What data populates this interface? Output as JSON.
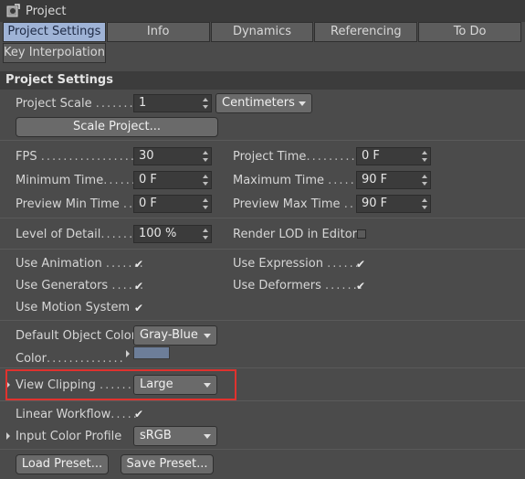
{
  "window": {
    "title": "Project",
    "icon": "project-gear-icon"
  },
  "tabs": [
    {
      "label": "Project Settings",
      "active": true
    },
    {
      "label": "Info",
      "active": false
    },
    {
      "label": "Dynamics",
      "active": false
    },
    {
      "label": "Referencing",
      "active": false
    },
    {
      "label": "To Do",
      "active": false
    }
  ],
  "tabs_row2": [
    {
      "label": "Key Interpolation",
      "active": false
    }
  ],
  "section": {
    "title": "Project Settings"
  },
  "project_scale": {
    "label": "Project Scale",
    "dots": "........",
    "value": "1",
    "unit": "Centimeters",
    "scale_button": "Scale Project..."
  },
  "time": {
    "fps": {
      "label": "FPS",
      "dots": "...................",
      "value": "30"
    },
    "project_time": {
      "label": "Project Time",
      "dots": "..........",
      "value": "0 F"
    },
    "min_time": {
      "label": "Minimum Time",
      "dots": "......",
      "value": "0 F"
    },
    "max_time": {
      "label": "Maximum Time",
      "dots": ".....",
      "value": "90 F"
    },
    "preview_min": {
      "label": "Preview Min Time",
      "dots": "..",
      "value": "0 F"
    },
    "preview_max": {
      "label": "Preview Max Time",
      "dots": "...",
      "value": "90 F"
    }
  },
  "lod": {
    "label": "Level of Detail",
    "dots": ".......",
    "value": "100 %",
    "render_lod_label": "Render LOD in Editor",
    "render_lod_checked": false
  },
  "toggles": {
    "use_animation": {
      "label": "Use Animation",
      "dots": ".......",
      "checked": true
    },
    "use_expression": {
      "label": "Use Expression",
      "dots": "......",
      "checked": true
    },
    "use_generators": {
      "label": "Use Generators",
      "dots": "......",
      "checked": true
    },
    "use_deformers": {
      "label": "Use Deformers",
      "dots": ".......",
      "checked": true
    },
    "use_motion": {
      "label": "Use Motion System",
      "checked": true
    }
  },
  "object_color": {
    "label": "Default Object Color",
    "value": "Gray-Blue",
    "color_label": "Color",
    "color_dots": "..............",
    "swatch": "#6d7e99"
  },
  "view_clipping": {
    "label": "View Clipping",
    "dots": ".......",
    "value": "Large",
    "highlight_color": "#e0322e"
  },
  "color_mgmt": {
    "linear_label": "Linear Workflow",
    "linear_dots": ".....",
    "linear_checked": true,
    "profile_label": "Input Color Profile",
    "profile_value": "sRGB"
  },
  "presets": {
    "load": "Load Preset...",
    "save": "Save Preset..."
  }
}
